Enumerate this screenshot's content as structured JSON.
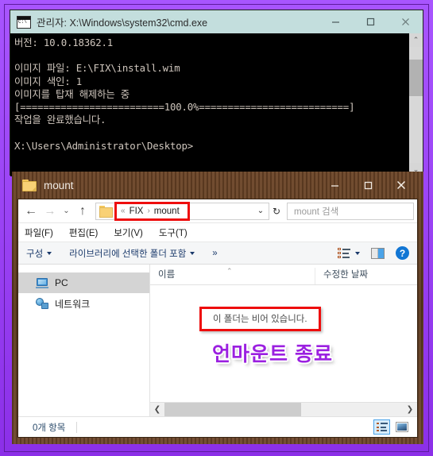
{
  "cmd_window": {
    "title": "관리자: X:\\Windows\\system32\\cmd.exe",
    "icon": "cmd-icon",
    "minimize": "—",
    "maximize": "□",
    "close": "✕",
    "console_text": "버전: 10.0.18362.1\n\n이미지 파일: E:\\FIX\\install.wim\n이미지 색인: 1\n이미지를 탑재 해제하는 중\n[=========================100.0%==========================]\n작업을 완료했습니다.\n\nX:\\Users\\Administrator\\Desktop>",
    "scroll_up": "⌃",
    "scroll_down": "⌄"
  },
  "explorer": {
    "title": "mount",
    "minimize": "—",
    "maximize": "□",
    "close": "✕",
    "nav": {
      "back": "←",
      "forward": "→",
      "recent": "⌄",
      "up": "↑"
    },
    "address": {
      "separator_start": "«",
      "crumb1": "FIX",
      "crumb_sep": "›",
      "crumb2": "mount",
      "dropdown": "⌄",
      "refresh": "↻"
    },
    "search": {
      "placeholder": "mount 검색"
    },
    "menu": [
      "파일(F)",
      "편집(E)",
      "보기(V)",
      "도구(T)"
    ],
    "toolbar": {
      "organize": "구성",
      "include_library": "라이브러리에 선택한 폴더 포함",
      "overflow": "»",
      "view_icon": "view-options-icon",
      "pane_icon": "preview-pane-icon",
      "help_icon": "help-icon"
    },
    "sidebar": [
      {
        "label": "PC",
        "icon": "computer-icon",
        "selected": true
      },
      {
        "label": "네트워크",
        "icon": "network-icon",
        "selected": false
      }
    ],
    "columns": [
      {
        "label": "이름",
        "sort": "⌃"
      },
      {
        "label": "수정한 날짜"
      }
    ],
    "empty_message": "이 폴더는 비어 있습니다.",
    "annotation_text": "언마운트 종료",
    "scroll_left": "❮",
    "scroll_right": "❯",
    "status": {
      "item_count": "0개 항목",
      "details_view": "details-view-icon",
      "large_icons_view": "large-icons-view-icon"
    }
  },
  "colors": {
    "border_purple": "#9b4dff",
    "cmd_title_bg": "#c3dedd",
    "explorer_frame": "#5a3a22",
    "highlight_red": "#ee0d0d",
    "annotation_purple": "#9b20e0",
    "accent_blue": "#1176d4"
  }
}
